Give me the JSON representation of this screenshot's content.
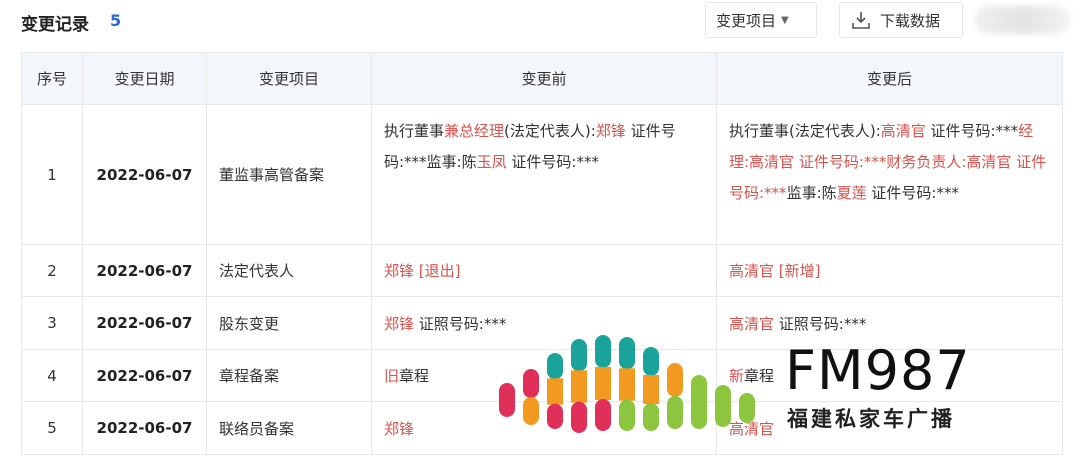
{
  "header": {
    "title": "变更记录",
    "count": "5"
  },
  "toolbar": {
    "select_label": "变更项目",
    "download_label": "下载数据"
  },
  "table": {
    "columns": [
      "序号",
      "变更日期",
      "变更项目",
      "变更前",
      "变更后"
    ],
    "rows": [
      {
        "num": "1",
        "date": "2022-06-07",
        "item": "董监事高管备案",
        "before": [
          {
            "t": "执行董事",
            "hl": false
          },
          {
            "t": "兼总经理",
            "hl": true
          },
          {
            "t": "(法定代表人):",
            "hl": false
          },
          {
            "t": "郑锋",
            "hl": true
          },
          {
            "t": " 证件号码:***监事:陈",
            "hl": false
          },
          {
            "t": "玉凤",
            "hl": true
          },
          {
            "t": " 证件号码:***",
            "hl": false
          }
        ],
        "after": [
          {
            "t": "执行董事(法定代表人):",
            "hl": false
          },
          {
            "t": "高清官",
            "hl": true
          },
          {
            "t": " 证件号码:***",
            "hl": false
          },
          {
            "t": "经理:高清官 证件号码:***财务负责人:高清官 证件号码:***",
            "hl": true
          },
          {
            "t": "监事:陈",
            "hl": false
          },
          {
            "t": "夏莲",
            "hl": true
          },
          {
            "t": " 证件号码:***",
            "hl": false
          }
        ]
      },
      {
        "num": "2",
        "date": "2022-06-07",
        "item": "法定代表人",
        "before": [
          {
            "t": "郑锋 [退出]",
            "hl": true
          }
        ],
        "after": [
          {
            "t": "高清官 [新增]",
            "hl": true
          }
        ]
      },
      {
        "num": "3",
        "date": "2022-06-07",
        "item": "股东变更",
        "before": [
          {
            "t": "郑锋",
            "hl": true
          },
          {
            "t": " 证照号码:***",
            "hl": false
          }
        ],
        "after": [
          {
            "t": "高清官",
            "hl": true
          },
          {
            "t": " 证照号码:***",
            "hl": false
          }
        ]
      },
      {
        "num": "4",
        "date": "2022-06-07",
        "item": "章程备案",
        "before": [
          {
            "t": "旧",
            "hl": true
          },
          {
            "t": "章程",
            "hl": false
          }
        ],
        "after": [
          {
            "t": "新",
            "hl": true
          },
          {
            "t": "章程",
            "hl": false
          }
        ]
      },
      {
        "num": "5",
        "date": "2022-06-07",
        "item": "联络员备案",
        "before": [
          {
            "t": "郑锋",
            "hl": true
          }
        ],
        "after": [
          {
            "t": "高清官",
            "hl": true
          }
        ]
      }
    ]
  },
  "watermark": {
    "brand": "FM987",
    "sub": "福建私家车广播"
  },
  "icons": {
    "select_caret": "caret-down-icon",
    "download": "download-icon"
  },
  "colors": {
    "accent": "#2a6ad8",
    "highlight": "#d9534f",
    "header_bg": "#f3f6fb"
  }
}
